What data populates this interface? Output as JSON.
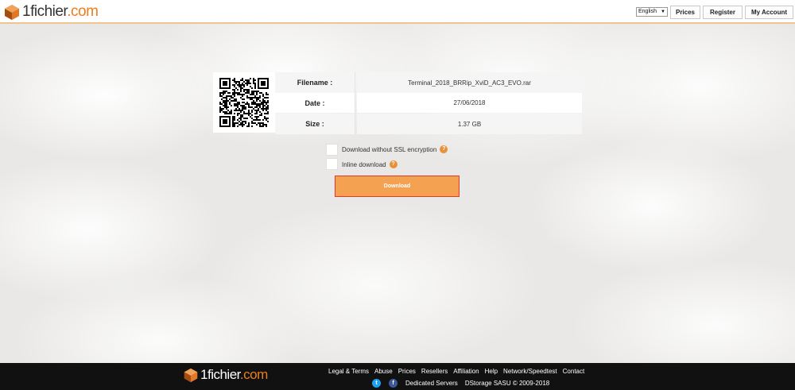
{
  "header": {
    "logo_prefix": "1",
    "logo_name": "fichier",
    "logo_suffix": ".com",
    "language": "English",
    "nav": [
      {
        "label": "Prices"
      },
      {
        "label": "Register"
      },
      {
        "label": "My Account"
      }
    ]
  },
  "file": {
    "rows": [
      {
        "label": "Filename :",
        "value": "Terminal_2018_BRRip_XviD_AC3_EVO.rar"
      },
      {
        "label": "Date :",
        "value": "27/06/2018"
      },
      {
        "label": "Size :",
        "value": "1.37 GB"
      }
    ]
  },
  "options": {
    "no_ssl": {
      "label": "Download without SSL encryption",
      "checked": false
    },
    "inline": {
      "label": "Inline download",
      "checked": false
    },
    "help_glyph": "?"
  },
  "download_button": "Download",
  "footer": {
    "links": [
      "Legal & Terms",
      "Abuse",
      "Prices",
      "Resellers",
      "Affiliation",
      "Help",
      "Network/Speedtest",
      "Contact"
    ],
    "dedicated": "Dedicated Servers",
    "copyright": "DStorage SASU © 2009-2018",
    "social": [
      {
        "icon": "twitter-icon",
        "glyph": "t",
        "color": "#1da1f2"
      },
      {
        "icon": "facebook-icon",
        "glyph": "f",
        "color": "#3b5998"
      }
    ]
  },
  "colors": {
    "accent": "#f07d1c",
    "button": "#f4a152",
    "button_border": "#e23a2f",
    "footer_bg": "#111111"
  }
}
